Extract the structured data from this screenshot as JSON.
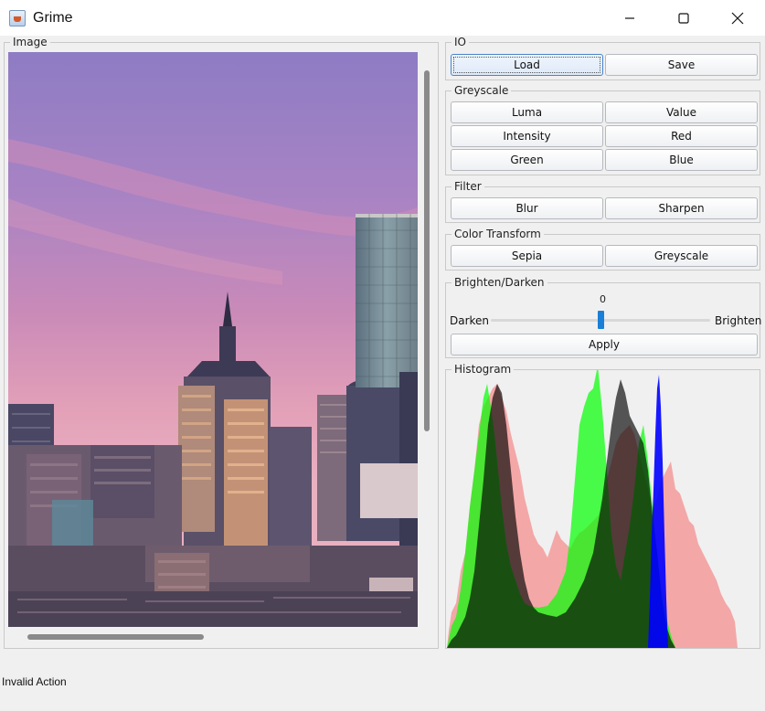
{
  "window": {
    "title": "Grime",
    "icon": "java-cup-icon",
    "controls": [
      "minimize-icon",
      "maximize-icon",
      "close-icon"
    ]
  },
  "image_panel": {
    "legend": "Image"
  },
  "io": {
    "legend": "IO",
    "load_label": "Load",
    "save_label": "Save"
  },
  "greyscale": {
    "legend": "Greyscale",
    "buttons": [
      "Luma",
      "Value",
      "Intensity",
      "Red",
      "Green",
      "Blue"
    ]
  },
  "filter": {
    "legend": "Filter",
    "buttons": [
      "Blur",
      "Sharpen"
    ]
  },
  "color_transform": {
    "legend": "Color Transform",
    "buttons": [
      "Sepia",
      "Greyscale"
    ]
  },
  "brighten": {
    "legend": "Brighten/Darken",
    "value": "0",
    "min_label": "Darken",
    "max_label": "Brighten",
    "apply_label": "Apply",
    "thumb_color": "#1a7fd6"
  },
  "histogram": {
    "legend": "Histogram",
    "series_colors": {
      "red": "#ff0000",
      "green": "#00ff00",
      "blue": "#0000ff",
      "intensity": "#000000"
    }
  },
  "status": {
    "text": "Invalid Action"
  }
}
